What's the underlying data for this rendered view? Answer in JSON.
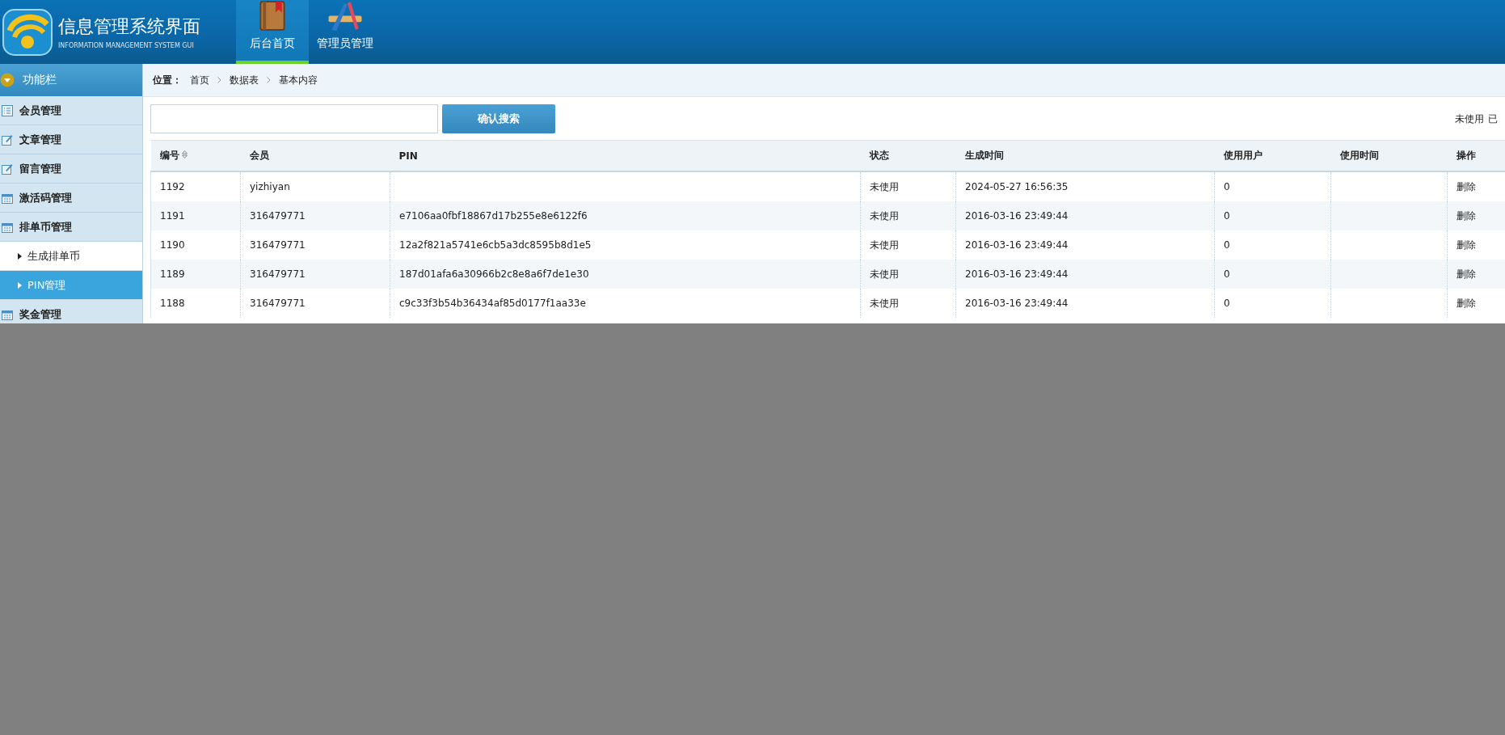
{
  "header": {
    "title": "信息管理系统界面",
    "subtitle": "INFORMATION MANAGEMENT SYSTEM GUI",
    "nav": [
      {
        "label": "后台首页",
        "selected": true
      },
      {
        "label": "管理员管理",
        "selected": false
      }
    ]
  },
  "sidebar": {
    "title": "功能栏",
    "items": [
      {
        "label": "会员管理"
      },
      {
        "label": "文章管理"
      },
      {
        "label": "留言管理"
      },
      {
        "label": "激活码管理"
      },
      {
        "label": "排单币管理",
        "children": [
          {
            "label": "生成排单币",
            "selected": false
          },
          {
            "label": "PIN管理",
            "selected": true
          }
        ]
      },
      {
        "label": "奖金管理"
      }
    ]
  },
  "breadcrumb": {
    "label": "位置：",
    "items": [
      "首页",
      "数据表",
      "基本内容"
    ]
  },
  "search": {
    "button": "确认搜索"
  },
  "filters": [
    "未使用",
    "已"
  ],
  "table": {
    "columns": [
      {
        "label": "编号",
        "sortable": true
      },
      {
        "label": "会员",
        "sortable": false
      },
      {
        "label": "PIN",
        "sortable": false
      },
      {
        "label": "状态",
        "sortable": false
      },
      {
        "label": "生成时间",
        "sortable": false
      },
      {
        "label": "使用用户",
        "sortable": false
      },
      {
        "label": "使用时间",
        "sortable": false
      },
      {
        "label": "操作",
        "sortable": false
      }
    ],
    "rows": [
      [
        "1192",
        "yizhiyan",
        "",
        "未使用",
        "2024-05-27 16:56:35",
        "0",
        "",
        "删除"
      ],
      [
        "1191",
        "316479771",
        "e7106aa0fbf18867d17b255e8e6122f6",
        "未使用",
        "2016-03-16 23:49:44",
        "0",
        "",
        "删除"
      ],
      [
        "1190",
        "316479771",
        "12a2f821a5741e6cb5a3dc8595b8d1e5",
        "未使用",
        "2016-03-16 23:49:44",
        "0",
        "",
        "删除"
      ],
      [
        "1189",
        "316479771",
        "187d01afa6a30966b2c8e8a6f7de1e30",
        "未使用",
        "2016-03-16 23:49:44",
        "0",
        "",
        "删除"
      ],
      [
        "1188",
        "316479771",
        "c9c33f3b54b36434af85d0177f1aa33e",
        "未使用",
        "2016-03-16 23:49:44",
        "0",
        "",
        "删除"
      ]
    ]
  }
}
